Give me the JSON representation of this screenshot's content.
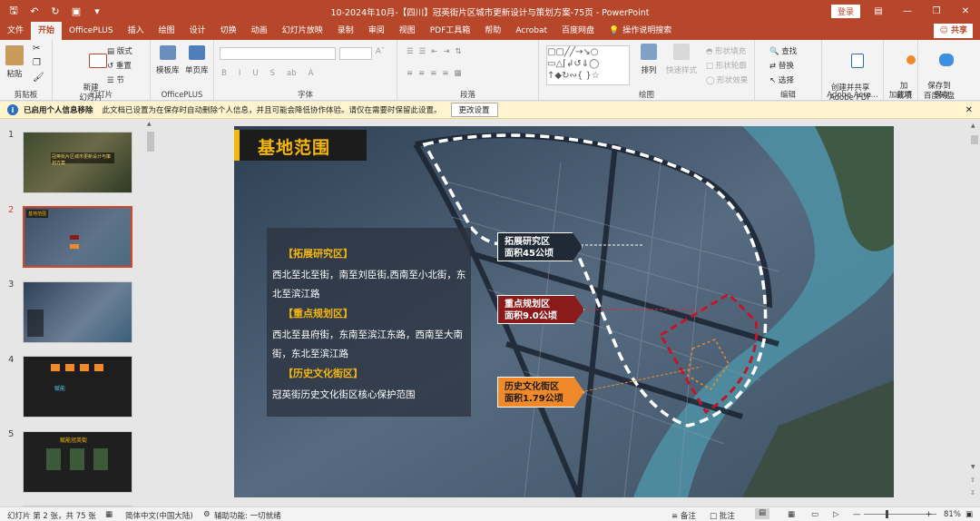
{
  "window": {
    "title": "10-2024年10月-【四川】冠英街片区城市更新设计与策划方案-75页  -  PowerPoint",
    "login_label": "登录",
    "quick_access": [
      "save-icon",
      "undo-icon",
      "redo-icon",
      "present-icon",
      "customize-icon"
    ],
    "controls": [
      "ribbon-display-icon",
      "minimize-icon",
      "restore-icon",
      "close-icon"
    ]
  },
  "tabs": [
    "文件",
    "开始",
    "OfficePLUS",
    "插入",
    "绘图",
    "设计",
    "切换",
    "动画",
    "幻灯片放映",
    "录制",
    "审阅",
    "视图",
    "PDF工具箱",
    "帮助",
    "Acrobat",
    "百度网盘"
  ],
  "active_tab": "开始",
  "tell_me": "操作说明搜索",
  "share_label": "共享",
  "ribbon": {
    "clipboard": {
      "label": "剪贴板",
      "paste": "粘贴"
    },
    "slides": {
      "label": "幻灯片",
      "new_slide": "新建\n幻灯片",
      "layout": "版式",
      "reset": "重置",
      "section": "节"
    },
    "officeplus": {
      "label": "OfficePLUS",
      "template": "模板库",
      "single": "单页库"
    },
    "font": {
      "label": "字体",
      "buttons": [
        "B",
        "I",
        "U",
        "S",
        "ab",
        "A"
      ]
    },
    "paragraph": {
      "label": "段落"
    },
    "drawing": {
      "label": "绘图",
      "arrange": "排列",
      "quick_styles": "快速样式",
      "fill": "形状填充",
      "outline": "形状轮廓",
      "effects": "形状效果"
    },
    "editing": {
      "label": "编辑",
      "find": "查找",
      "replace": "替换",
      "select": "选择"
    },
    "adobe": {
      "label": "Adobe Acro...",
      "create": "创建并共享\nAdobe PDF"
    },
    "addins": {
      "label": "加载项",
      "addin": "加\n载项"
    },
    "save": {
      "label": "保存",
      "save_to": "保存到\n百度网盘"
    }
  },
  "infobar": {
    "title": "已启用个人信息移除",
    "message": "此文档已设置为在保存时自动删除个人信息，并且可能会降低协作体验。请仅在需要时保留此设置。",
    "button": "更改设置"
  },
  "thumbnails": [
    {
      "num": "1",
      "caption": "冠英街片区城市更新设计与策划方案"
    },
    {
      "num": "2",
      "caption": "基地范围"
    },
    {
      "num": "3",
      "caption": ""
    },
    {
      "num": "4",
      "caption": "赋能"
    },
    {
      "num": "5",
      "caption": "赋能冠英街"
    }
  ],
  "slide": {
    "title": "基地范围",
    "sections": [
      {
        "heading": "【拓展研究区】",
        "body": "西北至北至街，南至刘臣街,西南至小北街，东北至滨江路"
      },
      {
        "heading": "【重点规划区】",
        "body": "西北至县府街，东南至滨江东路，西南至大南街，东北至滨江路"
      },
      {
        "heading": "【历史文化街区】",
        "body": "冠英街历史文化街区核心保护范围"
      }
    ],
    "labels": [
      {
        "name": "拓展研究区",
        "area": "面积45公顷"
      },
      {
        "name": "重点规划区",
        "area": "面积9.0公顷"
      },
      {
        "name": "历史文化街区",
        "area": "面积1.79公顷"
      }
    ],
    "colors": {
      "accent": "#f5b70f",
      "red": "#8b1a1a",
      "orange": "#f0892a",
      "panel": "#2b3340"
    }
  },
  "status": {
    "slide_info": "幻灯片 第 2 张，共 75 张",
    "language": "简体中文(中国大陆)",
    "accessibility": "辅助功能: 一切就绪",
    "notes": "备注",
    "comments": "批注",
    "zoom": "81%"
  }
}
